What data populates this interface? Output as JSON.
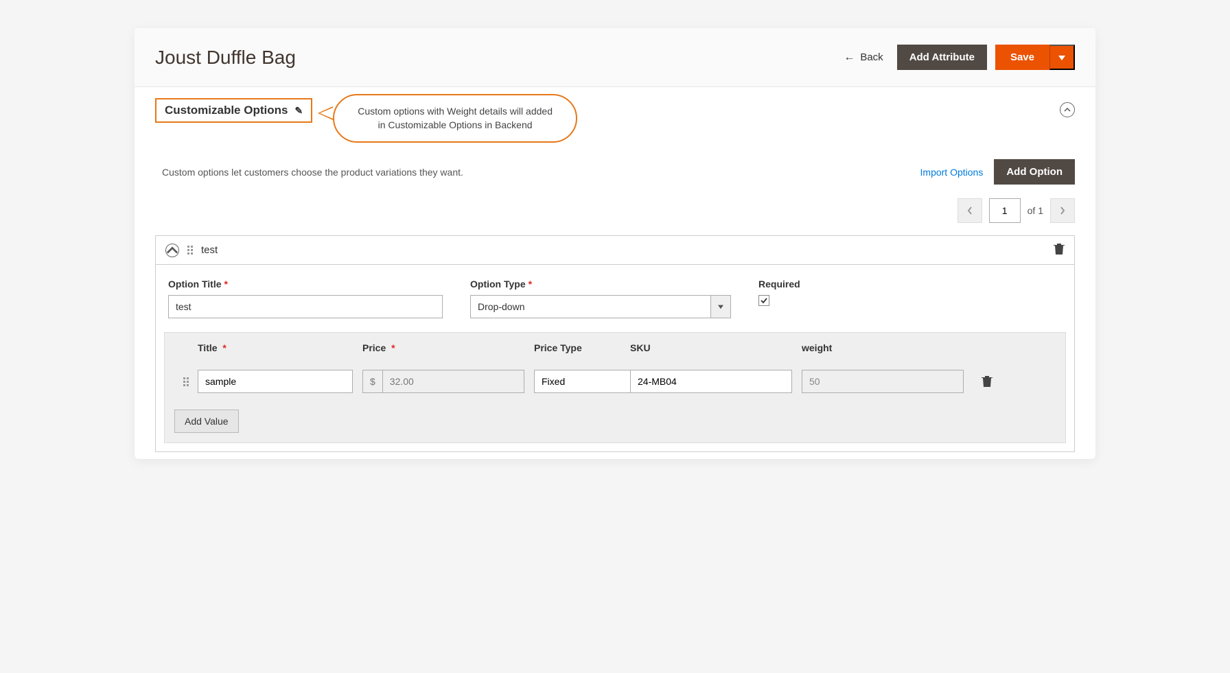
{
  "header": {
    "title": "Joust Duffle Bag",
    "back": "Back",
    "add_attribute": "Add Attribute",
    "save": "Save"
  },
  "section": {
    "label": "Customizable Options",
    "callout_line1": "Custom options with Weight details will added",
    "callout_line2": "in Customizable Options in Backend"
  },
  "desc": {
    "text": "Custom options let customers choose the product variations they want.",
    "import": "Import Options",
    "add_option": "Add Option"
  },
  "pager": {
    "page": "1",
    "of_label": "of 1"
  },
  "option": {
    "name": "test",
    "field_title_label": "Option Title",
    "field_title_value": "test",
    "field_type_label": "Option Type",
    "field_type_value": "Drop-down",
    "field_required_label": "Required"
  },
  "values": {
    "headers": {
      "title": "Title",
      "price": "Price",
      "ptype": "Price Type",
      "sku": "SKU",
      "weight": "weight"
    },
    "row": {
      "title": "sample",
      "price_prefix": "$",
      "price": "32.00",
      "ptype": "Fixed",
      "sku": "24-MB04",
      "weight": "50"
    },
    "add_value": "Add Value"
  }
}
